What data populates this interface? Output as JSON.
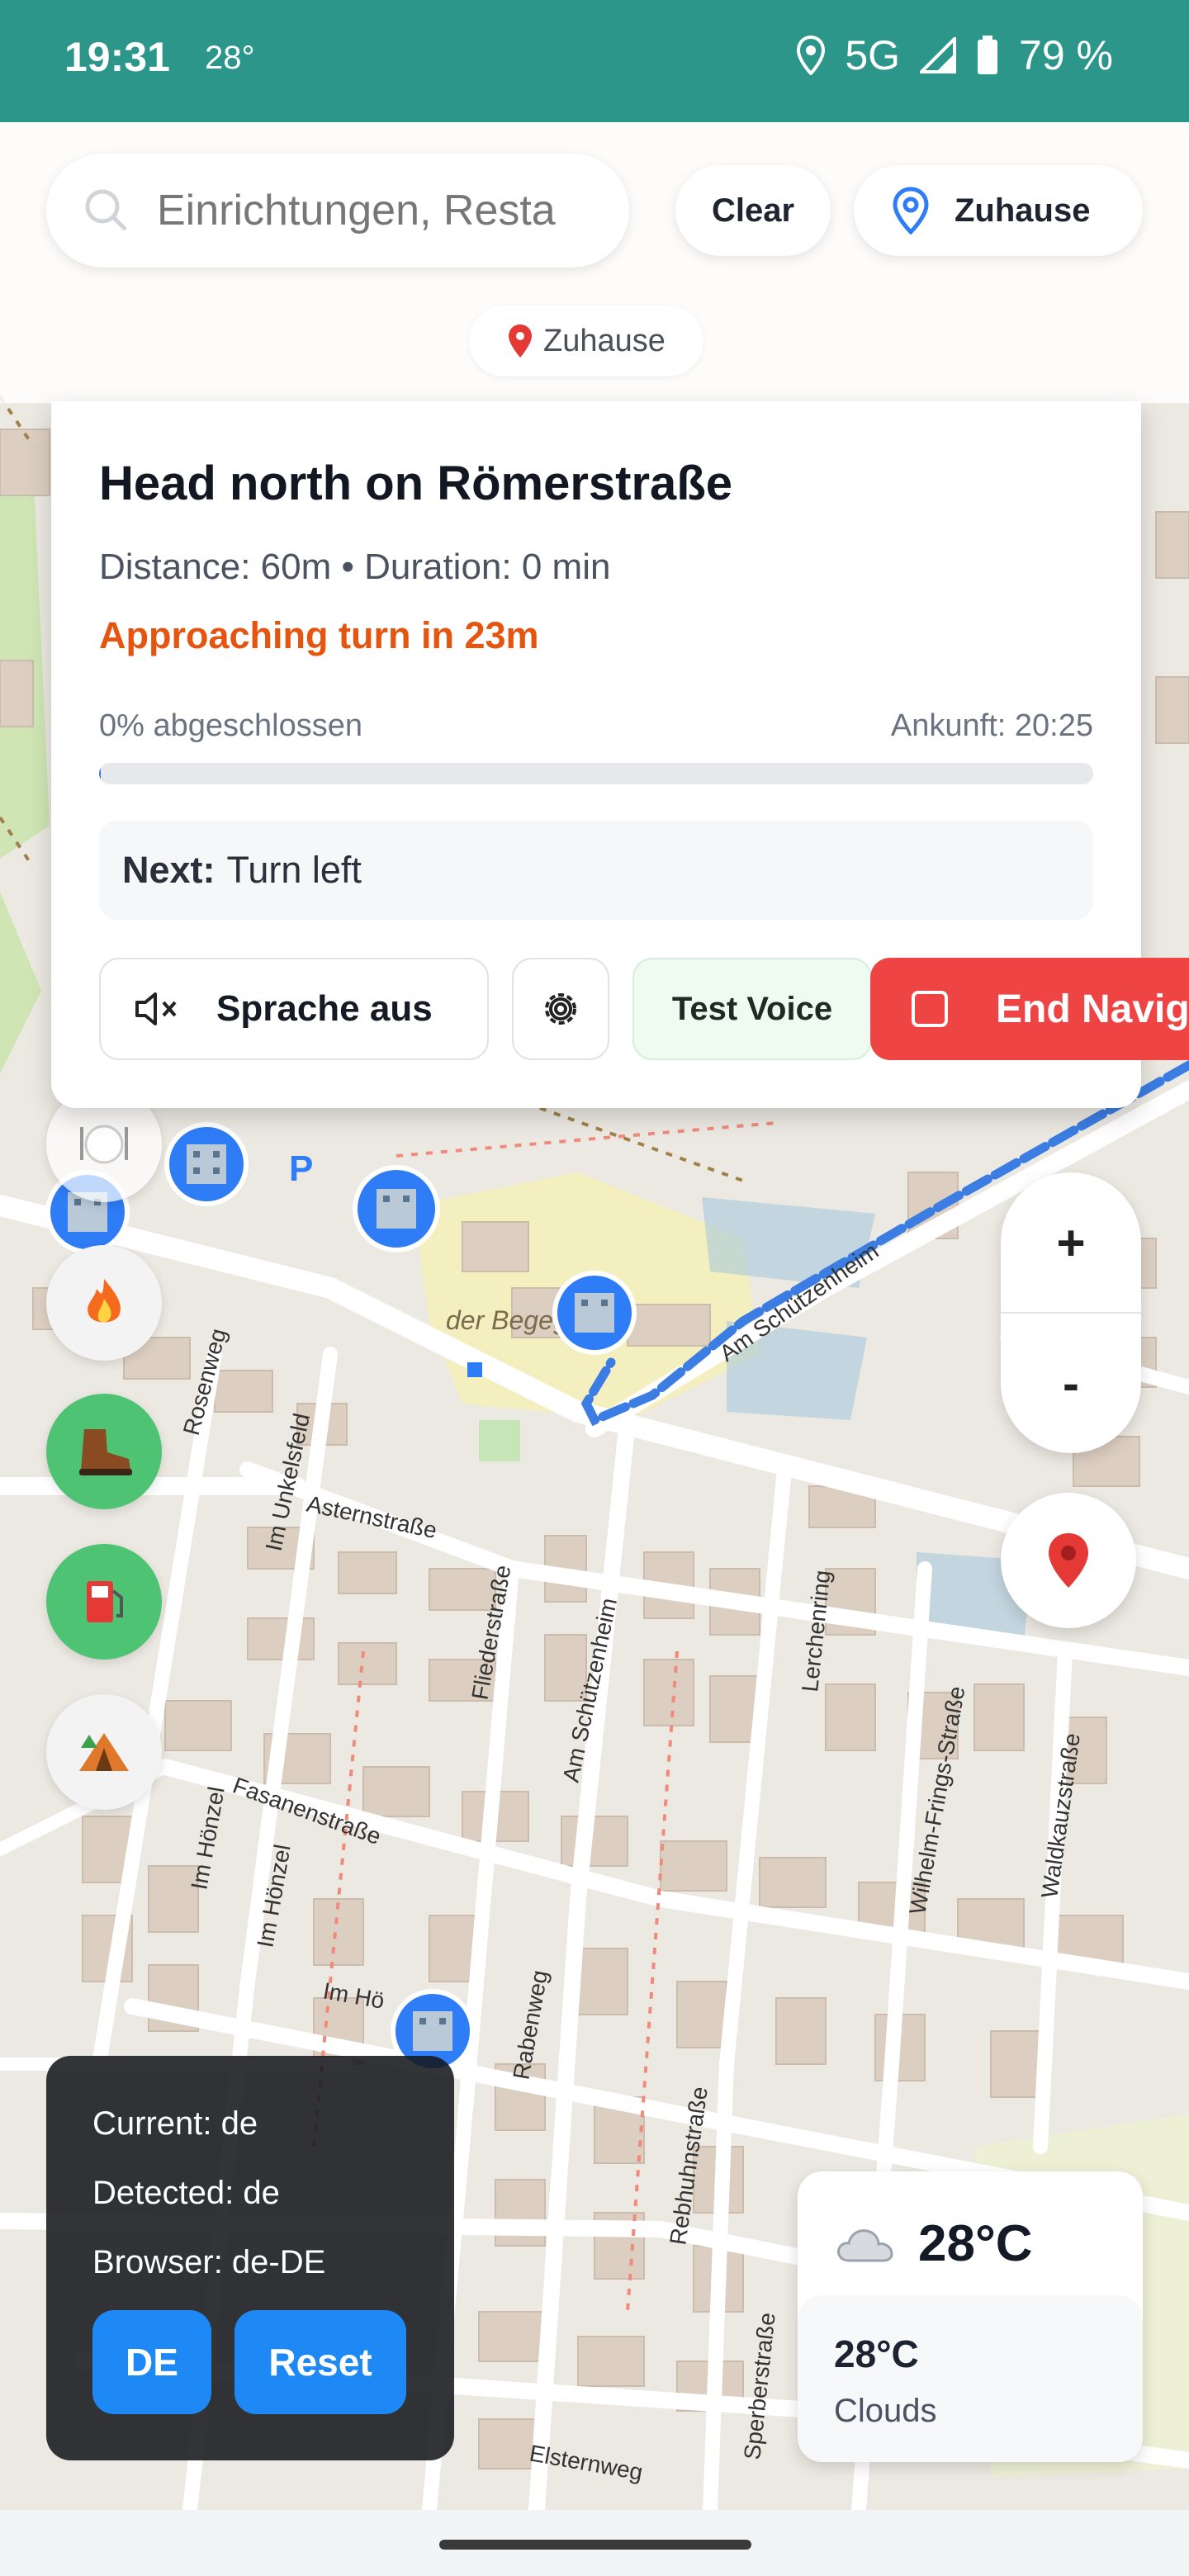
{
  "status_bar": {
    "time": "19:31",
    "temp": "28°",
    "network": "5G",
    "battery": "79 %"
  },
  "search": {
    "placeholder": "Einrichtungen, Resta"
  },
  "header": {
    "clear_label": "Clear",
    "home_label": "Zuhause",
    "location_chip": "Zuhause"
  },
  "navigation": {
    "instruction": "Head north on Römerstraße",
    "meta": "Distance: 60m • Duration: 0 min",
    "warning": "Approaching turn in 23m",
    "progress_label": "0% abgeschlossen",
    "progress_fraction": 0.0,
    "arrival": "Ankunft: 20:25",
    "next_prefix": "Next:",
    "next_value": "Turn left",
    "voice_label": "Sprache aus",
    "test_voice_label": "Test Voice",
    "end_label": "End Naviga"
  },
  "map": {
    "street_labels": [
      "Asternstraße",
      "Fliederstraße",
      "Am Schützenheim",
      "Rosenweg",
      "Im Unkelsfeld",
      "Lerchenring",
      "Wilhelm-Frings-Straße",
      "Waldkauzstraße",
      "Fasanenstraße",
      "Im Hönzel",
      "Rabenweg",
      "Rebhuhnstraße",
      "Sperberstraße",
      "Elsternweg",
      "Im Hö",
      "Im Hönzel",
      "Am Schützenheim"
    ],
    "place_label": "der Begegnung",
    "colors": {
      "route": "#3b7de3",
      "poi": "#2e7cf6"
    }
  },
  "controls": {
    "zoom_in": "+",
    "zoom_out": "-"
  },
  "categories": [
    "restaurant-icon",
    "fire-icon",
    "hiking-boot-icon",
    "fuel-icon",
    "camping-icon"
  ],
  "language_panel": {
    "current": "Current: de",
    "detected": "Detected: de",
    "browser": "Browser: de-DE",
    "de_button": "DE",
    "reset_button": "Reset"
  },
  "weather": {
    "temp_main": "28°C",
    "temp_detail": "28°C",
    "description": "Clouds"
  },
  "colors": {
    "status_bar": "#2b9689",
    "end_button": "#ef4444",
    "warning": "#e5550f",
    "primary": "#1e88f5"
  }
}
